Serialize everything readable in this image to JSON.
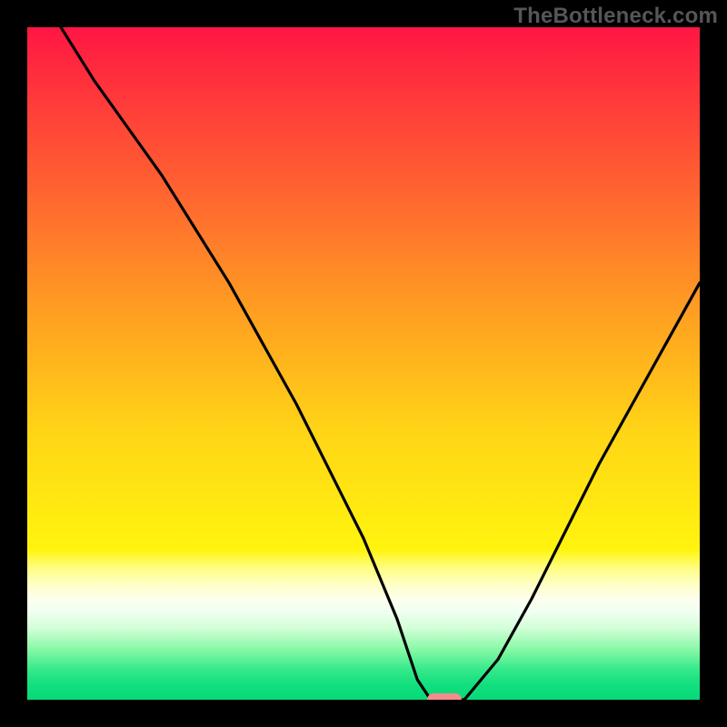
{
  "watermark": "TheBottleneck.com",
  "colors": {
    "marker": "#f58b8b",
    "curve": "#000000",
    "frame": "#000000"
  },
  "chart_data": {
    "type": "line",
    "title": "",
    "xlabel": "",
    "ylabel": "",
    "xlim": [
      0,
      100
    ],
    "ylim": [
      0,
      100
    ],
    "series": [
      {
        "name": "bottleneck-curve",
        "x": [
          5,
          10,
          15,
          20,
          25,
          30,
          35,
          40,
          45,
          50,
          55,
          58,
          60,
          62,
          65,
          70,
          75,
          80,
          85,
          90,
          95,
          100
        ],
        "y": [
          100,
          92,
          85,
          78,
          70,
          62,
          53,
          44,
          34,
          24,
          12,
          3,
          0,
          0,
          0,
          6,
          15,
          25,
          35,
          44,
          53,
          62
        ]
      }
    ],
    "marker": {
      "x": 62,
      "y": 0
    },
    "grid": false,
    "legend": false
  }
}
